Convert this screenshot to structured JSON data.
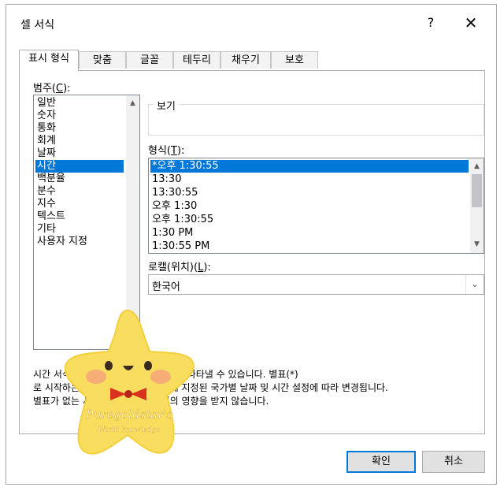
{
  "dialog": {
    "title": "셀 서식",
    "help_label": "?",
    "close_label": "✕"
  },
  "tabs": [
    {
      "label": "표시 형식",
      "active": true
    },
    {
      "label": "맞춤",
      "active": false
    },
    {
      "label": "글꼴",
      "active": false
    },
    {
      "label": "테두리",
      "active": false
    },
    {
      "label": "채우기",
      "active": false
    },
    {
      "label": "보호",
      "active": false
    }
  ],
  "category": {
    "label_text": "범주(",
    "label_key": "C",
    "label_end": "):",
    "items": [
      "일반",
      "숫자",
      "통화",
      "회계",
      "날짜",
      "시간",
      "백분율",
      "분수",
      "지수",
      "텍스트",
      "기타",
      "사용자 지정"
    ],
    "selected_index": 5
  },
  "sample": {
    "legend": "보기",
    "value": ""
  },
  "format": {
    "label_text": "형식(",
    "label_key": "T",
    "label_end": "):",
    "items": [
      "*오후 1:30:55",
      "13:30",
      "13:30:55",
      "오후 1:30",
      "오후 1:30:55",
      "1:30 PM",
      "1:30:55 PM"
    ],
    "selected_index": 0
  },
  "locale": {
    "label_text": "로캘(위치)(",
    "label_key": "L",
    "label_end": "):",
    "value": "한국어"
  },
  "description": [
    "시간 서식은 일련의 숫자를 날짜값으로 나타낼 수 있습니다. 별표(*)",
    "로 시작하는 시간 서식은 운영 체제에 지정된 국가별 날짜 및 시간 설정에 따라 변경됩니다.",
    "별표가 없는 서식은 운영 체제 설정의 영향을 받지 않습니다."
  ],
  "buttons": {
    "ok": "확인",
    "cancel": "취소"
  },
  "sticker": {
    "text_line1": "Puregoldstar's",
    "text_line2": "World knowledge"
  }
}
